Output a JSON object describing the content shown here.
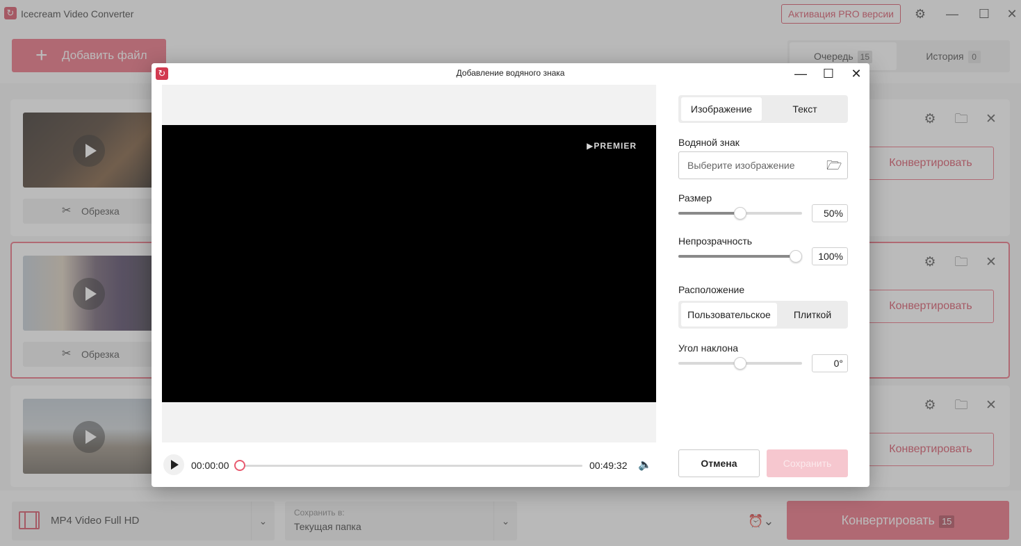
{
  "app": {
    "title": "Icecream Video Converter",
    "pro_button": "Активация PRO версии",
    "add_file": "Добавить файл",
    "tabs": [
      {
        "label": "Очередь",
        "count": "15",
        "active": true
      },
      {
        "label": "История",
        "count": "0",
        "active": false
      }
    ],
    "files": [
      {
        "trim_label": "Обрезка",
        "convert_label": "Конвертировать"
      },
      {
        "trim_label": "Обрезка",
        "convert_label": "Конвертировать"
      },
      {
        "trim_label": "",
        "convert_label": "Конвертировать"
      }
    ],
    "bottom": {
      "format": "MP4 Video Full HD",
      "save_to_label": "Сохранить в:",
      "save_to_value": "Текущая папка",
      "convert_label": "Конвертировать",
      "convert_count": "15"
    }
  },
  "modal": {
    "title": "Добавление водяного знака",
    "video_overlay_text": "▶PREMIER",
    "player": {
      "current_time": "00:00:00",
      "duration": "00:49:32",
      "progress": 0
    },
    "type_tabs": [
      {
        "label": "Изображение",
        "active": true
      },
      {
        "label": "Текст",
        "active": false
      }
    ],
    "watermark_label": "Водяной знак",
    "watermark_placeholder": "Выберите изображение",
    "size": {
      "label": "Размер",
      "value_text": "50%",
      "value": 50
    },
    "opacity": {
      "label": "Непрозрачность",
      "value_text": "100%",
      "value": 100
    },
    "position": {
      "label": "Расположение",
      "options": [
        {
          "label": "Пользовательское",
          "active": true
        },
        {
          "label": "Плиткой",
          "active": false
        }
      ]
    },
    "angle": {
      "label": "Угол наклона",
      "value_text": "0°",
      "value": 0,
      "min": -180,
      "max": 180
    },
    "cancel": "Отмена",
    "save": "Сохранить"
  },
  "colors": {
    "accent": "#e85a6f",
    "brand": "#d23a50"
  },
  "icons": [
    "app-logo-icon",
    "settings-icon",
    "minimize-icon",
    "maximize-icon",
    "close-icon",
    "plus-icon",
    "play-icon",
    "scissors-icon",
    "folder-icon",
    "film-icon",
    "chevron-down-icon",
    "alarm-clock-icon",
    "volume-icon",
    "folder-open-icon"
  ]
}
